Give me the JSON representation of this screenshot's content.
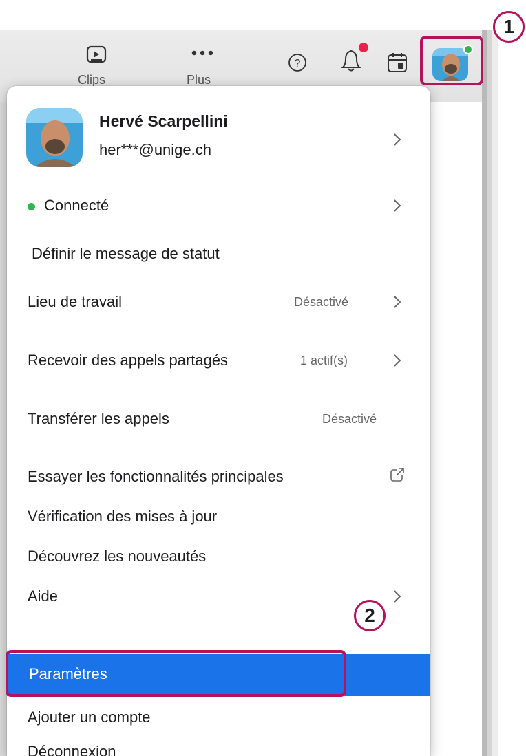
{
  "toolbar": {
    "clips_label": "Clips",
    "more_label": "Plus"
  },
  "profile": {
    "name": "Hervé Scarpellini",
    "email": "her***@unige.ch"
  },
  "menu": {
    "status": "Connecté",
    "set_status": "Définir le message de statut",
    "workplace": "Lieu de travail",
    "workplace_value": "Désactivé",
    "shared_calls": "Recevoir des appels partagés",
    "shared_calls_value": "1 actif(s)",
    "forward_calls": "Transférer les appels",
    "forward_calls_value": "Désactivé",
    "try_features": "Essayer les fonctionnalités principales",
    "check_updates": "Vérification des mises à jour",
    "whats_new": "Découvrez les nouveautés",
    "help": "Aide",
    "settings": "Paramètres",
    "add_account": "Ajouter un compte",
    "sign_out": "Déconnexion"
  },
  "callouts": {
    "one": "1",
    "two": "2"
  },
  "colors": {
    "accent": "#1a73e8",
    "callout": "#b5135a",
    "status_online": "#2db84d",
    "notification": "#e8224b"
  },
  "icons": [
    "clips-icon",
    "more-icon",
    "help-icon",
    "bell-icon",
    "calendar-icon",
    "avatar",
    "chevron-right-icon",
    "external-link-icon"
  ]
}
